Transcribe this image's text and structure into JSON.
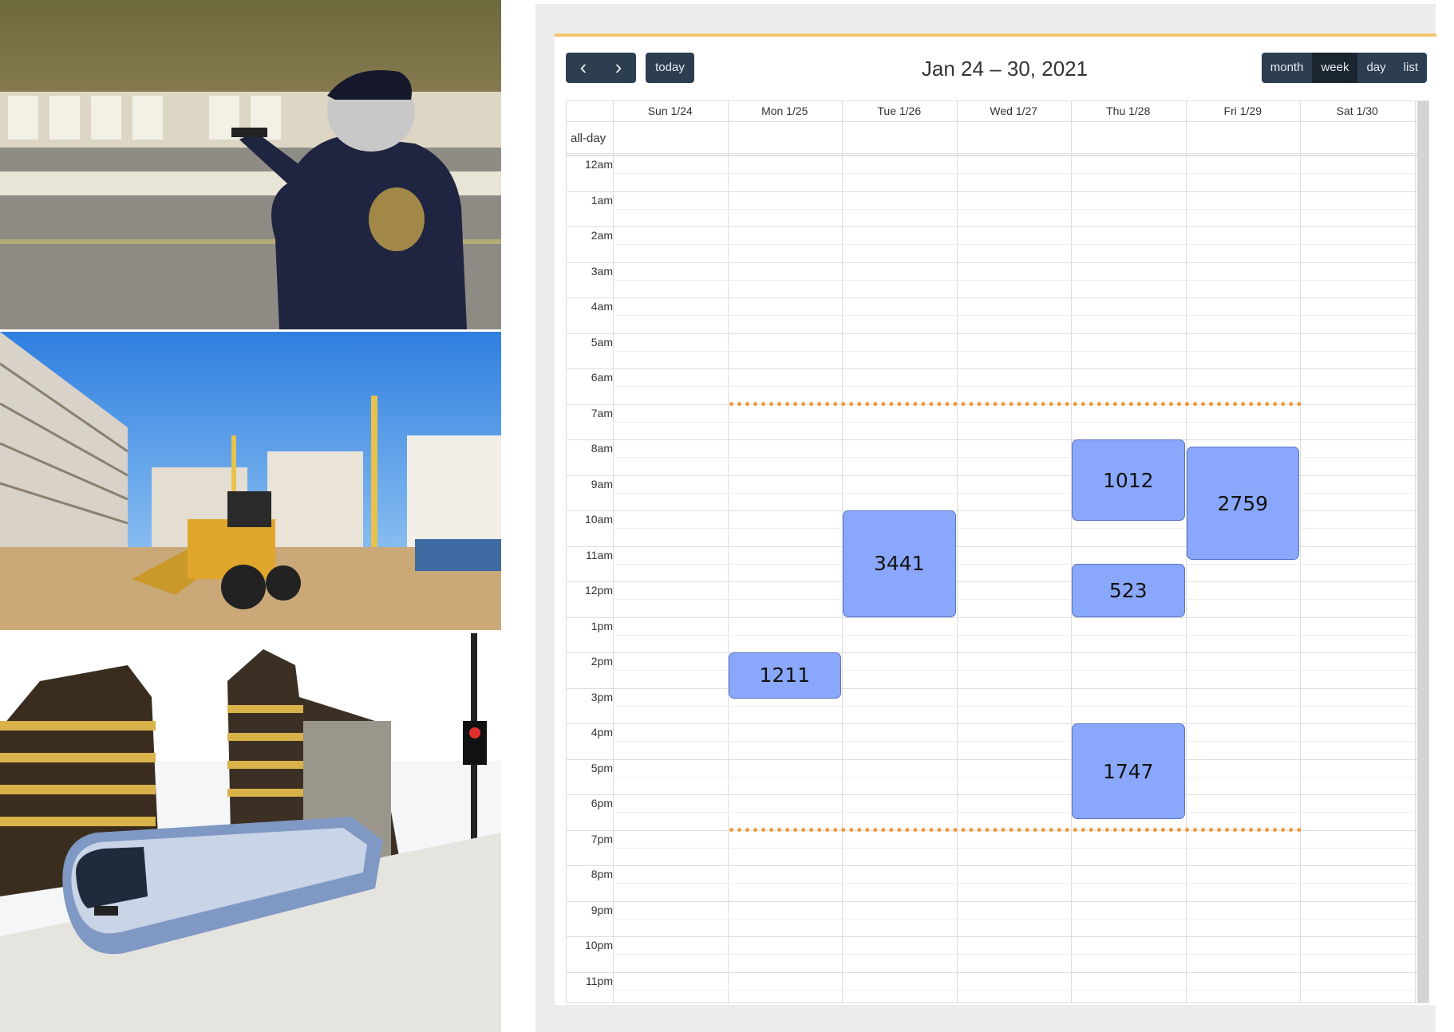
{
  "photos": [
    {
      "id": "photo-shooter",
      "subject": "range-shooter"
    },
    {
      "id": "photo-construction",
      "subject": "construction-site"
    },
    {
      "id": "photo-tram",
      "subject": "city-tram"
    }
  ],
  "calendar": {
    "title": "Jan 24 – 30, 2021",
    "prev_icon": "‹",
    "next_icon": "›",
    "today_label": "today",
    "views": [
      {
        "label": "month",
        "active": false
      },
      {
        "label": "week",
        "active": true
      },
      {
        "label": "day",
        "active": false
      },
      {
        "label": "list",
        "active": false
      }
    ],
    "allday_label": "all-day",
    "days": [
      "Sun 1/24",
      "Mon 1/25",
      "Tue 1/26",
      "Wed 1/27",
      "Thu 1/28",
      "Fri 1/29",
      "Sat 1/30"
    ],
    "hours": [
      "12am",
      "1am",
      "2am",
      "3am",
      "4am",
      "5am",
      "6am",
      "7am",
      "8am",
      "9am",
      "10am",
      "11am",
      "12pm",
      "1pm",
      "2pm",
      "3pm",
      "4pm",
      "5pm",
      "6pm",
      "7pm",
      "8pm",
      "9pm",
      "10pm",
      "11pm"
    ],
    "events": [
      {
        "label": "1012",
        "day": 4,
        "start": 8.0,
        "end": 10.3
      },
      {
        "label": "2759",
        "day": 5,
        "start": 8.2,
        "end": 11.4
      },
      {
        "label": "3441",
        "day": 2,
        "start": 10.0,
        "end": 13.0
      },
      {
        "label": "523",
        "day": 4,
        "start": 11.5,
        "end": 13.0
      },
      {
        "label": "1211",
        "day": 1,
        "start": 14.0,
        "end": 15.3
      },
      {
        "label": "1747",
        "day": 4,
        "start": 16.0,
        "end": 18.7
      }
    ],
    "marker_lines": [
      {
        "time": 7.0,
        "from_day": 1,
        "to_day": 6
      },
      {
        "time": 19.0,
        "from_day": 1,
        "to_day": 6
      }
    ],
    "colors": {
      "event": "#8aa8fb",
      "marker": "#f09a3a",
      "header_accent": "#f3c46b",
      "button": "#2c3e50"
    }
  }
}
